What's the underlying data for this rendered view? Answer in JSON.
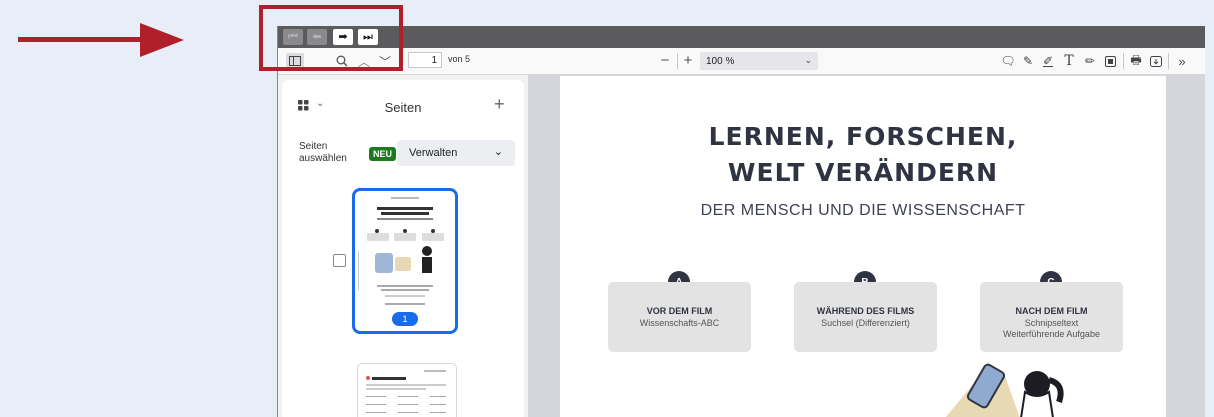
{
  "navigation": {
    "first_icon": "first-page-icon",
    "prev_icon": "previous-page-icon",
    "next_icon": "next-page-icon",
    "last_icon": "last-page-icon"
  },
  "toolbar": {
    "current_page": "1",
    "page_count_label": "von 5",
    "zoom_value": "100 %"
  },
  "sidebar": {
    "title": "Seiten",
    "select_label_line1": "Seiten",
    "select_label_line2": "auswählen",
    "new_badge": "NEU",
    "manage_label": "Verwalten",
    "thumbnail_page_number": "1"
  },
  "document": {
    "title_line1": "LERNEN, FORSCHEN,",
    "title_line2": "WELT VERÄNDERN",
    "subtitle": "DER MENSCH UND DIE WISSENSCHAFT",
    "cards": [
      {
        "badge": "A",
        "heading": "VOR DEM FILM",
        "line1": "Wissenschafts-ABC",
        "line2": ""
      },
      {
        "badge": "B",
        "heading": "WÄHREND DES FILMS",
        "line1": "Suchsel (Differenziert)",
        "line2": ""
      },
      {
        "badge": "C",
        "heading": "NACH DEM FILM",
        "line1": "Schnipseltext",
        "line2": "Weiterführende Aufgabe"
      }
    ]
  },
  "colors": {
    "highlight": "#b0202a",
    "accent_blue": "#1a6be8",
    "badge_green": "#1e7a1e",
    "title_dark": "#2f3342"
  }
}
